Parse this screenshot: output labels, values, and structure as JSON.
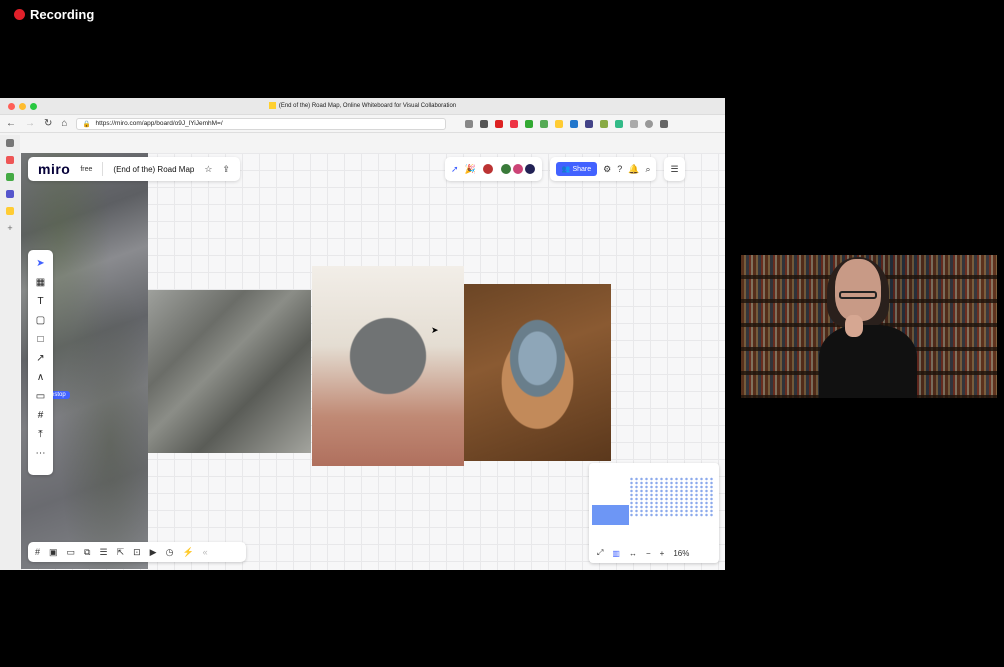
{
  "recording": {
    "label": "Recording"
  },
  "browser": {
    "tab_title": "(End of the) Road Map, Online Whiteboard for Visual Collaboration",
    "url": "https://miro.com/app/board/o9J_lYiJemhM=/"
  },
  "miro": {
    "logo": "miro",
    "plan": "free",
    "board_name": "(End of the) Road Map",
    "share_label": "Share",
    "zoom": "16%",
    "tooltip_fragment": "estop"
  },
  "colors": {
    "accent": "#4262ff",
    "recording_dot": "#e0202a"
  }
}
